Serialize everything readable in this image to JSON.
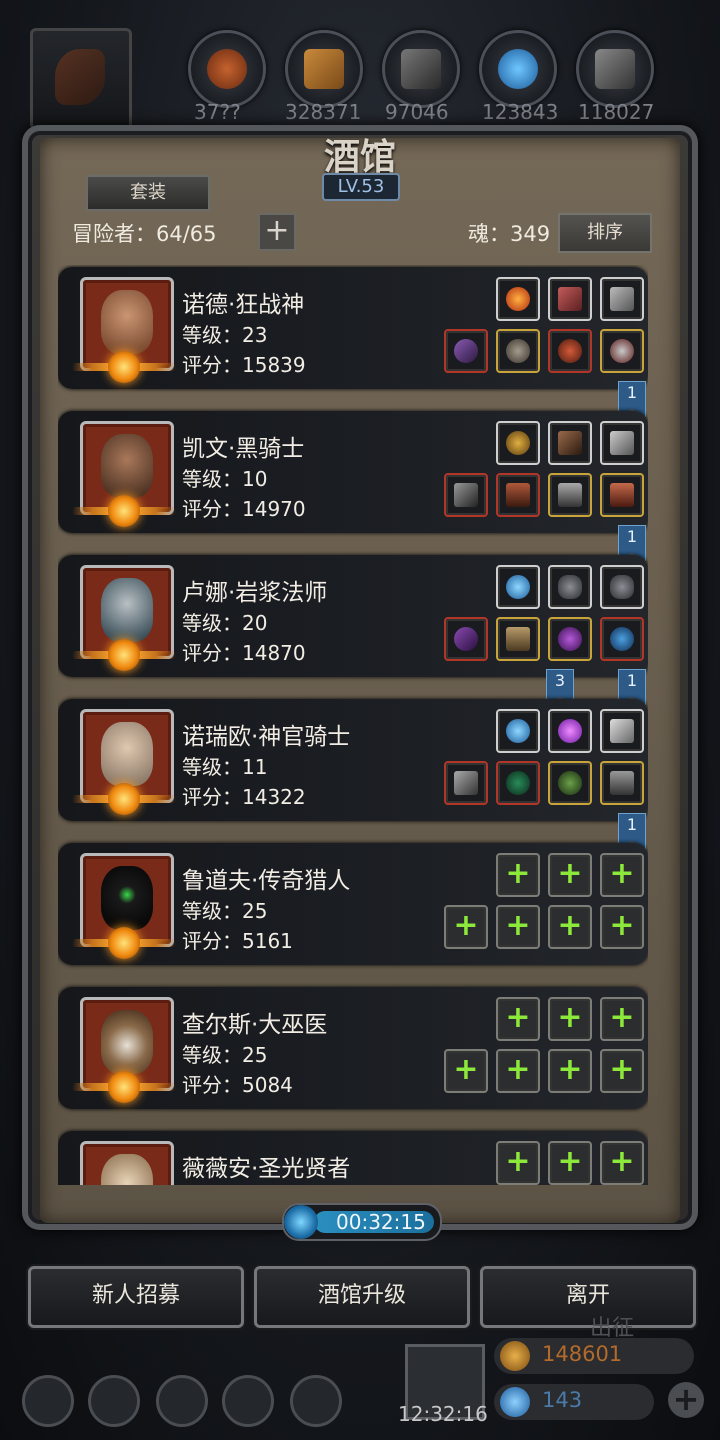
{
  "top": {
    "resources": [
      {
        "name": "meat-icon",
        "value": "37??"
      },
      {
        "name": "wood-icon",
        "value": "328371"
      },
      {
        "name": "iron-icon",
        "value": "97046"
      },
      {
        "name": "crystal-icon",
        "value": "123843"
      },
      {
        "name": "stone-icon",
        "value": "118027"
      }
    ]
  },
  "panel": {
    "title": "酒馆",
    "level": "LV.53",
    "set_button": "套装",
    "adventurers_label": "冒险者：64/65",
    "soul_label": "魂：349",
    "sort_button": "排序"
  },
  "heroes": [
    {
      "name": "诺德·狂战神",
      "level": "等级：23",
      "score": "评分：15839",
      "flags": []
    },
    {
      "name": "凯文·黑骑士",
      "level": "等级：10",
      "score": "评分：14970",
      "flags": [
        "1"
      ]
    },
    {
      "name": "卢娜·岩浆法师",
      "level": "等级：20",
      "score": "评分：14870",
      "flags": [
        "1"
      ]
    },
    {
      "name": "诺瑞欧·神官骑士",
      "level": "等级：11",
      "score": "评分：14322",
      "flags": [
        "3",
        "1"
      ]
    },
    {
      "name": "鲁道夫·传奇猎人",
      "level": "等级：25",
      "score": "评分：5161",
      "flags": [
        "1"
      ]
    },
    {
      "name": "查尔斯·大巫医",
      "level": "等级：25",
      "score": "评分：5084",
      "flags": []
    },
    {
      "name": "薇薇安·圣光贤者",
      "level": "",
      "score": "",
      "flags": []
    }
  ],
  "timer": "00:32:15",
  "buttons": {
    "recruit": "新人招募",
    "upgrade": "酒馆升级",
    "leave": "离开"
  },
  "bottom": {
    "clock": "12:32:16",
    "gold": "148601",
    "gems": "143",
    "expedition": "出征"
  },
  "colors": {
    "panel_bg": "#6e6354",
    "row_bg": "#1c1f24",
    "plus_green": "#8ce83a",
    "flag_blue": "#2d5a86"
  }
}
